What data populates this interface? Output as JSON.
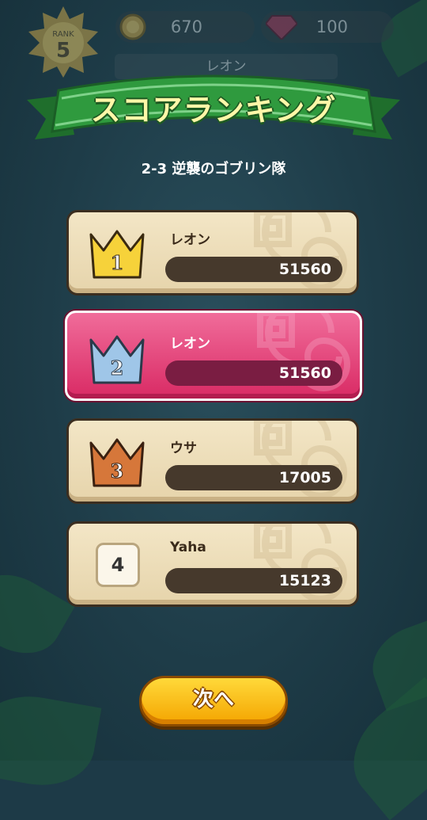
{
  "hud": {
    "rank_label": "RANK",
    "rank_value": "5",
    "coins": "670",
    "gems": "100",
    "player_name": "レオン"
  },
  "title": "スコアランキング",
  "stage": "2-3 逆襲のゴブリン隊",
  "ranking": [
    {
      "rank": "1",
      "name": "レオン",
      "score": "51560",
      "is_me": false
    },
    {
      "rank": "2",
      "name": "レオン",
      "score": "51560",
      "is_me": true
    },
    {
      "rank": "3",
      "name": "ウサ",
      "score": "17005",
      "is_me": false
    },
    {
      "rank": "4",
      "name": "Yaha",
      "score": "15123",
      "is_me": false
    }
  ],
  "next_button": "次へ",
  "colors": {
    "gold": "#f6d23a",
    "silver": "#9fc6e8",
    "bronze": "#d6773a",
    "me_row": "#e83e78",
    "banner_green": "#2e8b3e",
    "button": "#ffc21a"
  },
  "icons": [
    "rank-sun-icon",
    "coin-icon",
    "gem-icon",
    "crown-gold-icon",
    "crown-silver-icon",
    "crown-bronze-icon"
  ]
}
